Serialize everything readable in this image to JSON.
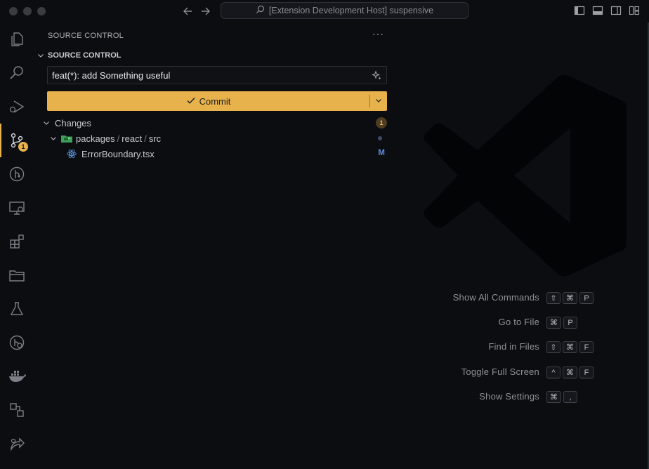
{
  "titlebar": {
    "search_text": "[Extension Development Host] suspensive"
  },
  "activity": {
    "scm_badge": "1"
  },
  "sidebar": {
    "title": "SOURCE CONTROL",
    "more": "···",
    "section": "SOURCE CONTROL",
    "commit_message": "feat(*): add Something useful",
    "commit_label": "Commit",
    "changes_label": "Changes",
    "changes_count": "1",
    "folder": {
      "part1": "packages",
      "part2": "react",
      "part3": "src"
    },
    "file": {
      "name": "ErrorBoundary.tsx",
      "status": "M"
    }
  },
  "editor": {
    "shortcuts": [
      {
        "label": "Show All Commands",
        "keys": [
          "⇧",
          "⌘",
          "P"
        ]
      },
      {
        "label": "Go to File",
        "keys": [
          "⌘",
          "P"
        ]
      },
      {
        "label": "Find in Files",
        "keys": [
          "⇧",
          "⌘",
          "F"
        ]
      },
      {
        "label": "Toggle Full Screen",
        "keys": [
          "^",
          "⌘",
          "F"
        ]
      },
      {
        "label": "Show Settings",
        "keys": [
          "⌘",
          ","
        ]
      }
    ]
  },
  "colors": {
    "accent": "#e7b24c",
    "background": "#0b0d11",
    "modified": "#5b8fd9"
  },
  "icons": {
    "activity": [
      "files-icon",
      "search-icon",
      "run-debug-icon",
      "source-control-icon",
      "git-graph-icon",
      "remote-explorer-icon",
      "extensions-icon",
      "folder-icon",
      "testing-icon",
      "github-icon",
      "docker-icon",
      "layout-icon",
      "live-share-icon"
    ]
  }
}
